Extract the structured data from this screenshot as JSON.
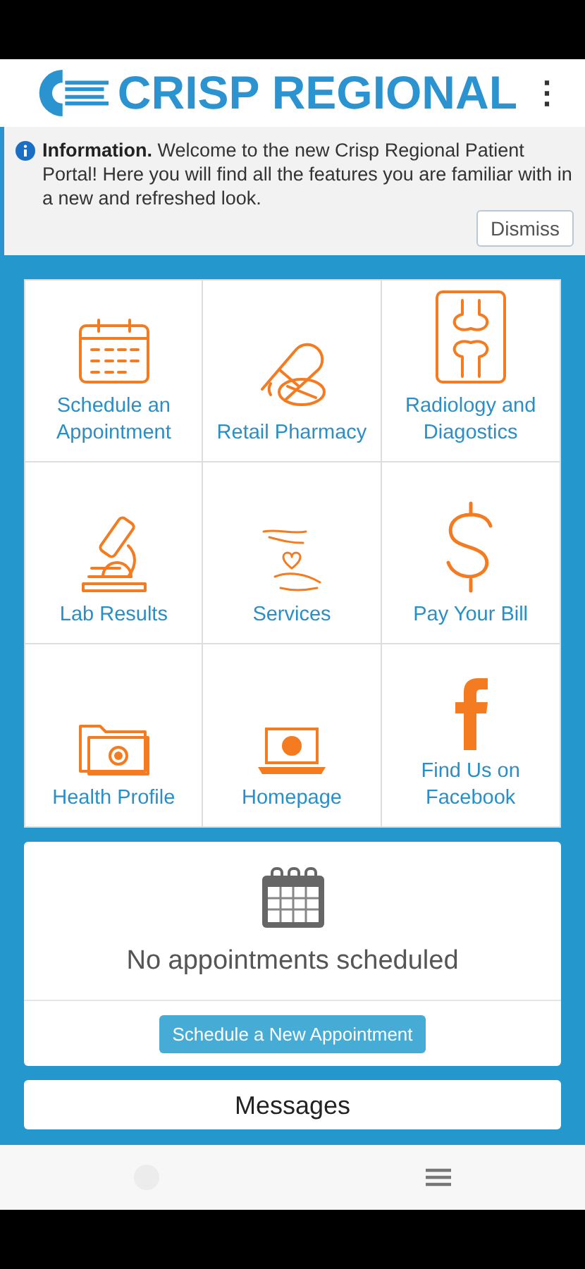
{
  "header": {
    "logo_text": "CRISP REGIONAL",
    "menu_icon": "⋮"
  },
  "info": {
    "text": "**Information.**  Welcome to the new Crisp Regional Patient Portal! Here you will find all the features you are familiar with in a new and refreshed look.",
    "dismiss": "Dismiss"
  },
  "tiles": [
    {
      "label": "Schedule an Appointment"
    },
    {
      "label": "Retail Pharmacy"
    },
    {
      "label": "Radiology and Diagostics"
    },
    {
      "label": "Lab Results"
    },
    {
      "label": "Services"
    },
    {
      "label": "Pay Your Bill"
    },
    {
      "label": "Health Profile"
    },
    {
      "label": "Homepage"
    },
    {
      "label": "Find Us on Facebook"
    }
  ],
  "appointments": {
    "empty_text": "No appointments scheduled",
    "button": "Schedule a New Appointment"
  },
  "messages": {
    "title": "Messages"
  }
}
